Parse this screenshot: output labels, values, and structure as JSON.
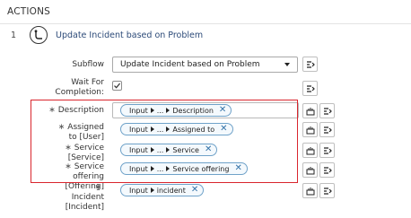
{
  "section": {
    "title": "ACTIONS"
  },
  "step": {
    "number": "1",
    "title": "Update Incident based on Problem",
    "icon": "flow-icon"
  },
  "fields": {
    "subflow": {
      "label": "Subflow",
      "value": "Update Incident based on Problem"
    },
    "wait": {
      "label_line1": "Wait For",
      "label_line2": "Completion:",
      "checked": true
    },
    "description": {
      "req": "∗",
      "label": "Description",
      "pill": [
        "Input",
        "...",
        "Description"
      ]
    },
    "assigned_to": {
      "req": "∗",
      "label_line1": "Assigned",
      "label_line2": "to [User]",
      "pill": [
        "Input",
        "...",
        "Assigned to"
      ]
    },
    "service": {
      "req": "∗",
      "label": "Service [Service]",
      "pill": [
        "Input",
        "...",
        "Service"
      ]
    },
    "service_offering": {
      "req": "∗",
      "label_line1": "Service",
      "label_line2": "offering [Offering]",
      "pill": [
        "Input",
        "...",
        "Service offering"
      ]
    },
    "incident": {
      "req": "∗",
      "label_line2": "Incident [Incident]",
      "pill": [
        "Input",
        "incident"
      ]
    }
  },
  "icons": {
    "data_pill_picker": "data-pill-picker-icon",
    "script_toggle": "script-toggle-icon",
    "remove": "close-icon"
  },
  "colors": {
    "highlight_border": "#d9262e",
    "pill_border": "#6fa2c9",
    "link_text": "#2c4a78"
  }
}
